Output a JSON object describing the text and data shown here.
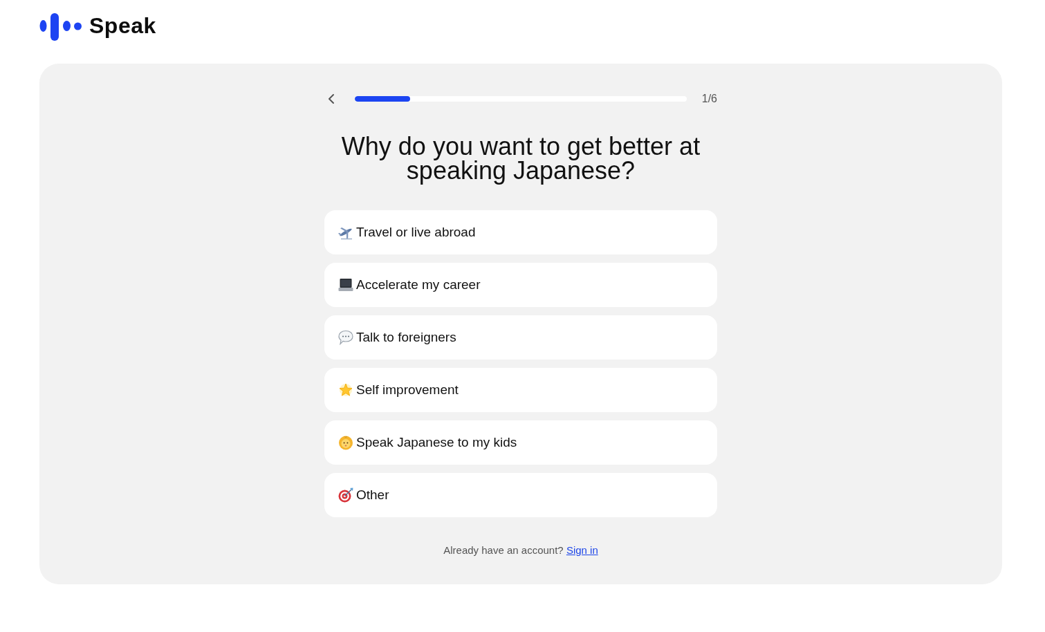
{
  "header": {
    "logo_text": "Speak"
  },
  "progress": {
    "level": 0.167,
    "counter": "1/6"
  },
  "question": "Why do you want to get better at speaking Japanese?",
  "options": [
    {
      "kind": "plane",
      "label": "Travel or live abroad",
      "selected": false
    },
    {
      "kind": "laptop",
      "label": "Accelerate my career",
      "selected": false
    },
    {
      "kind": "speech",
      "label": "Talk to foreigners",
      "selected": false
    },
    {
      "kind": "star",
      "label": "Self improvement",
      "selected": false
    },
    {
      "kind": "baby",
      "label": "Speak Japanese to my kids",
      "selected": false
    },
    {
      "kind": "target",
      "label": "Other",
      "selected": false
    }
  ],
  "footer": {
    "text": "Already have an account?",
    "link": "Sign in"
  }
}
